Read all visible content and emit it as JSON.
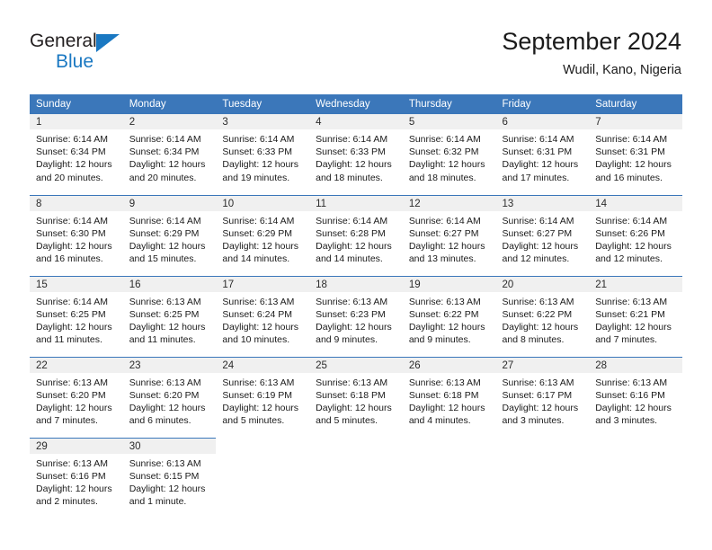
{
  "brand": {
    "name_line1": "General",
    "name_line2": "Blue",
    "accent_color": "#1a78c2"
  },
  "header": {
    "title": "September 2024",
    "subtitle": "Wudil, Kano, Nigeria"
  },
  "theme": {
    "header_blue": "#3b77ba",
    "daynum_gray": "#f0f0f0",
    "text": "#1a1a1a"
  },
  "weekday_headers": [
    "Sunday",
    "Monday",
    "Tuesday",
    "Wednesday",
    "Thursday",
    "Friday",
    "Saturday"
  ],
  "weeks": [
    [
      {
        "day": "1",
        "sunrise": "Sunrise: 6:14 AM",
        "sunset": "Sunset: 6:34 PM",
        "daylight": "Daylight: 12 hours and 20 minutes."
      },
      {
        "day": "2",
        "sunrise": "Sunrise: 6:14 AM",
        "sunset": "Sunset: 6:34 PM",
        "daylight": "Daylight: 12 hours and 20 minutes."
      },
      {
        "day": "3",
        "sunrise": "Sunrise: 6:14 AM",
        "sunset": "Sunset: 6:33 PM",
        "daylight": "Daylight: 12 hours and 19 minutes."
      },
      {
        "day": "4",
        "sunrise": "Sunrise: 6:14 AM",
        "sunset": "Sunset: 6:33 PM",
        "daylight": "Daylight: 12 hours and 18 minutes."
      },
      {
        "day": "5",
        "sunrise": "Sunrise: 6:14 AM",
        "sunset": "Sunset: 6:32 PM",
        "daylight": "Daylight: 12 hours and 18 minutes."
      },
      {
        "day": "6",
        "sunrise": "Sunrise: 6:14 AM",
        "sunset": "Sunset: 6:31 PM",
        "daylight": "Daylight: 12 hours and 17 minutes."
      },
      {
        "day": "7",
        "sunrise": "Sunrise: 6:14 AM",
        "sunset": "Sunset: 6:31 PM",
        "daylight": "Daylight: 12 hours and 16 minutes."
      }
    ],
    [
      {
        "day": "8",
        "sunrise": "Sunrise: 6:14 AM",
        "sunset": "Sunset: 6:30 PM",
        "daylight": "Daylight: 12 hours and 16 minutes."
      },
      {
        "day": "9",
        "sunrise": "Sunrise: 6:14 AM",
        "sunset": "Sunset: 6:29 PM",
        "daylight": "Daylight: 12 hours and 15 minutes."
      },
      {
        "day": "10",
        "sunrise": "Sunrise: 6:14 AM",
        "sunset": "Sunset: 6:29 PM",
        "daylight": "Daylight: 12 hours and 14 minutes."
      },
      {
        "day": "11",
        "sunrise": "Sunrise: 6:14 AM",
        "sunset": "Sunset: 6:28 PM",
        "daylight": "Daylight: 12 hours and 14 minutes."
      },
      {
        "day": "12",
        "sunrise": "Sunrise: 6:14 AM",
        "sunset": "Sunset: 6:27 PM",
        "daylight": "Daylight: 12 hours and 13 minutes."
      },
      {
        "day": "13",
        "sunrise": "Sunrise: 6:14 AM",
        "sunset": "Sunset: 6:27 PM",
        "daylight": "Daylight: 12 hours and 12 minutes."
      },
      {
        "day": "14",
        "sunrise": "Sunrise: 6:14 AM",
        "sunset": "Sunset: 6:26 PM",
        "daylight": "Daylight: 12 hours and 12 minutes."
      }
    ],
    [
      {
        "day": "15",
        "sunrise": "Sunrise: 6:14 AM",
        "sunset": "Sunset: 6:25 PM",
        "daylight": "Daylight: 12 hours and 11 minutes."
      },
      {
        "day": "16",
        "sunrise": "Sunrise: 6:13 AM",
        "sunset": "Sunset: 6:25 PM",
        "daylight": "Daylight: 12 hours and 11 minutes."
      },
      {
        "day": "17",
        "sunrise": "Sunrise: 6:13 AM",
        "sunset": "Sunset: 6:24 PM",
        "daylight": "Daylight: 12 hours and 10 minutes."
      },
      {
        "day": "18",
        "sunrise": "Sunrise: 6:13 AM",
        "sunset": "Sunset: 6:23 PM",
        "daylight": "Daylight: 12 hours and 9 minutes."
      },
      {
        "day": "19",
        "sunrise": "Sunrise: 6:13 AM",
        "sunset": "Sunset: 6:22 PM",
        "daylight": "Daylight: 12 hours and 9 minutes."
      },
      {
        "day": "20",
        "sunrise": "Sunrise: 6:13 AM",
        "sunset": "Sunset: 6:22 PM",
        "daylight": "Daylight: 12 hours and 8 minutes."
      },
      {
        "day": "21",
        "sunrise": "Sunrise: 6:13 AM",
        "sunset": "Sunset: 6:21 PM",
        "daylight": "Daylight: 12 hours and 7 minutes."
      }
    ],
    [
      {
        "day": "22",
        "sunrise": "Sunrise: 6:13 AM",
        "sunset": "Sunset: 6:20 PM",
        "daylight": "Daylight: 12 hours and 7 minutes."
      },
      {
        "day": "23",
        "sunrise": "Sunrise: 6:13 AM",
        "sunset": "Sunset: 6:20 PM",
        "daylight": "Daylight: 12 hours and 6 minutes."
      },
      {
        "day": "24",
        "sunrise": "Sunrise: 6:13 AM",
        "sunset": "Sunset: 6:19 PM",
        "daylight": "Daylight: 12 hours and 5 minutes."
      },
      {
        "day": "25",
        "sunrise": "Sunrise: 6:13 AM",
        "sunset": "Sunset: 6:18 PM",
        "daylight": "Daylight: 12 hours and 5 minutes."
      },
      {
        "day": "26",
        "sunrise": "Sunrise: 6:13 AM",
        "sunset": "Sunset: 6:18 PM",
        "daylight": "Daylight: 12 hours and 4 minutes."
      },
      {
        "day": "27",
        "sunrise": "Sunrise: 6:13 AM",
        "sunset": "Sunset: 6:17 PM",
        "daylight": "Daylight: 12 hours and 3 minutes."
      },
      {
        "day": "28",
        "sunrise": "Sunrise: 6:13 AM",
        "sunset": "Sunset: 6:16 PM",
        "daylight": "Daylight: 12 hours and 3 minutes."
      }
    ],
    [
      {
        "day": "29",
        "sunrise": "Sunrise: 6:13 AM",
        "sunset": "Sunset: 6:16 PM",
        "daylight": "Daylight: 12 hours and 2 minutes."
      },
      {
        "day": "30",
        "sunrise": "Sunrise: 6:13 AM",
        "sunset": "Sunset: 6:15 PM",
        "daylight": "Daylight: 12 hours and 1 minute."
      },
      {
        "day": "",
        "sunrise": "",
        "sunset": "",
        "daylight": ""
      },
      {
        "day": "",
        "sunrise": "",
        "sunset": "",
        "daylight": ""
      },
      {
        "day": "",
        "sunrise": "",
        "sunset": "",
        "daylight": ""
      },
      {
        "day": "",
        "sunrise": "",
        "sunset": "",
        "daylight": ""
      },
      {
        "day": "",
        "sunrise": "",
        "sunset": "",
        "daylight": ""
      }
    ]
  ]
}
